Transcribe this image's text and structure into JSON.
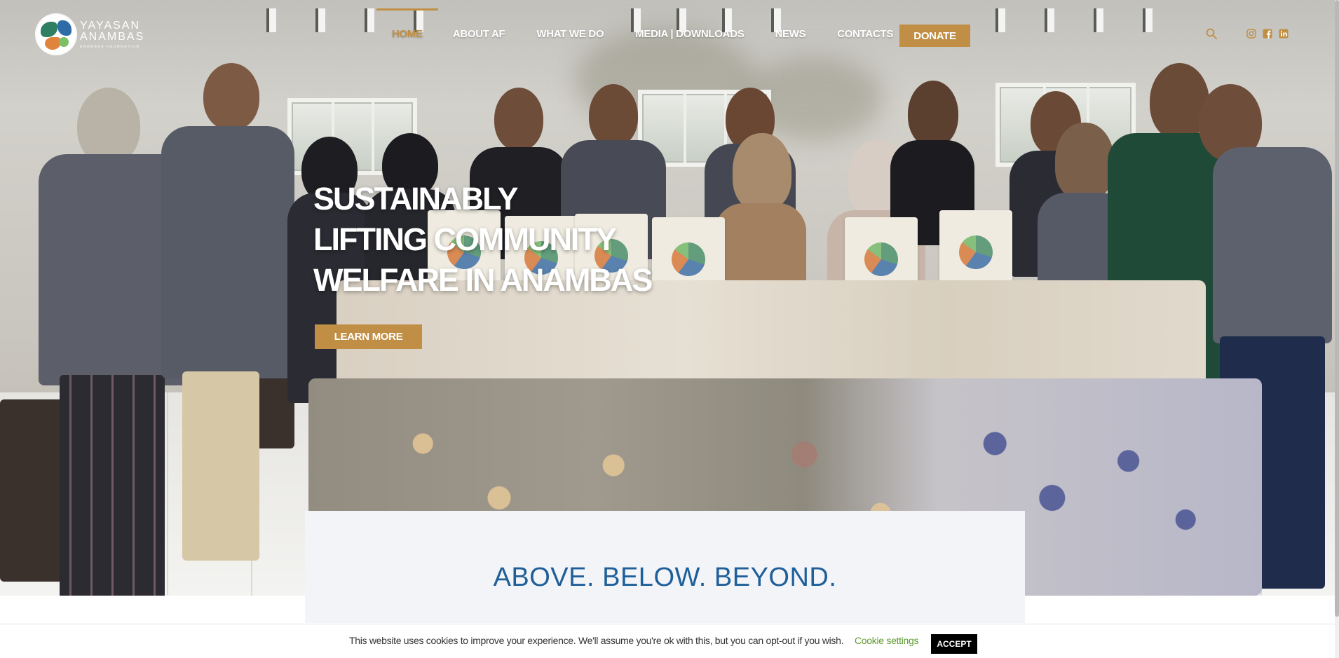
{
  "brand": {
    "line1": "YAYASAN",
    "line2": "ANAMBAS",
    "line3": "ANAMBAS FOUNDATION",
    "colors": {
      "gold": "#c08f45",
      "blue": "#1f5f99",
      "card": "#f2f4f8"
    }
  },
  "nav": {
    "items": [
      {
        "label": "HOME",
        "active": true
      },
      {
        "label": "ABOUT AF",
        "active": false
      },
      {
        "label": "WHAT WE DO",
        "active": false
      },
      {
        "label": "MEDIA | DOWNLOADS",
        "active": false
      },
      {
        "label": "NEWS",
        "active": false
      },
      {
        "label": "CONTACTS",
        "active": false
      }
    ],
    "donate_label": "DONATE",
    "icons": [
      "search-icon",
      "instagram-icon",
      "facebook-icon",
      "linkedin-icon"
    ]
  },
  "hero": {
    "title_lines": [
      "SUSTAINABLY",
      "LIFTING COMMUNITY",
      "WELFARE IN ANAMBAS"
    ],
    "cta_label": "LEARN MORE",
    "image": "group photo of community members holding tote bags behind eco-printed fabrics"
  },
  "tagline": "ABOVE. BELOW. BEYOND.",
  "cookie": {
    "message": "This website uses cookies to improve your experience. We'll assume you're ok with this, but you can opt-out if you wish.",
    "settings_label": "Cookie settings",
    "accept_label": "ACCEPT"
  }
}
